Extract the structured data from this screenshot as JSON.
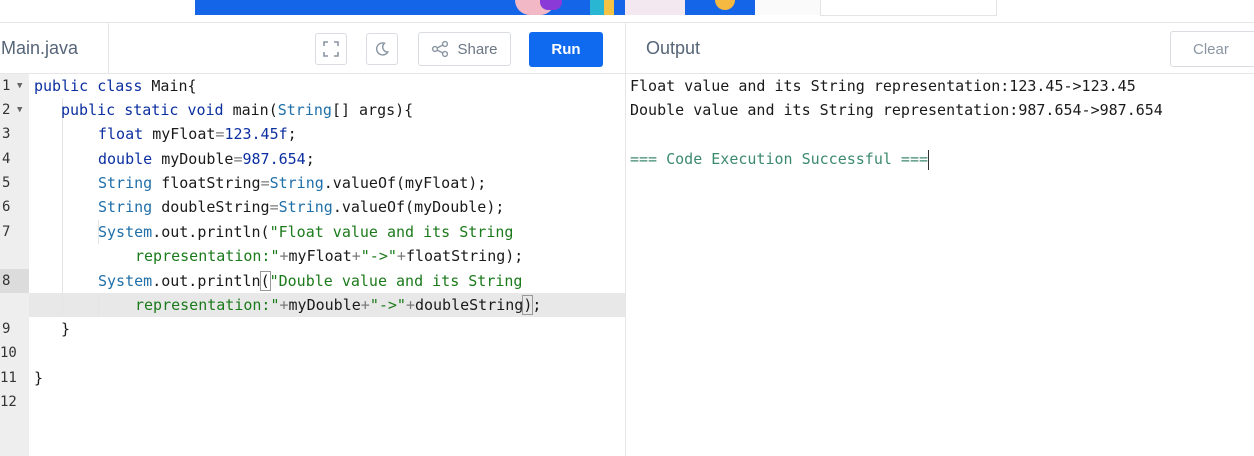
{
  "editor": {
    "filename": "Main.java",
    "share_label": "Share",
    "run_label": "Run",
    "line_numbers": [
      "1",
      "2",
      "3",
      "4",
      "5",
      "6",
      "7",
      "8",
      "9",
      "10",
      "11",
      "12"
    ],
    "code": {
      "l1": [
        "public",
        "class",
        "Main{"
      ],
      "l2": [
        "public",
        "static",
        "void",
        "main(",
        "String",
        "[] args){"
      ],
      "l3": [
        "float",
        "myFloat",
        "=",
        "123.45f",
        ";"
      ],
      "l4": [
        "double",
        "myDouble",
        "=",
        "987.654",
        ";"
      ],
      "l5": [
        "String",
        "floatString",
        "=",
        "String",
        ".valueOf(myFloat);"
      ],
      "l6": [
        "String",
        "doubleString",
        "=",
        "String",
        ".valueOf(myDouble);"
      ],
      "l7": [
        "System",
        ".out.println(",
        "\"Float value and its String"
      ],
      "l7b": [
        "representation:\"",
        "+",
        "myFloat",
        "+",
        "\"->\"",
        "+",
        "floatString);"
      ],
      "l8": [
        "System",
        ".out.println",
        "(",
        "\"Double value and its String"
      ],
      "l8b": [
        "representation:\"",
        "+",
        "myDouble",
        "+",
        "\"->\"",
        "+",
        "doubleString",
        ")",
        ";"
      ],
      "l9": "}",
      "l11": "}"
    }
  },
  "output": {
    "title": "Output",
    "clear_label": "Clear",
    "lines": [
      "Float value and its String representation:123.45->123.45",
      "Double value and its String representation:987.654->987.654"
    ],
    "success": "=== Code Execution Successful ==="
  }
}
